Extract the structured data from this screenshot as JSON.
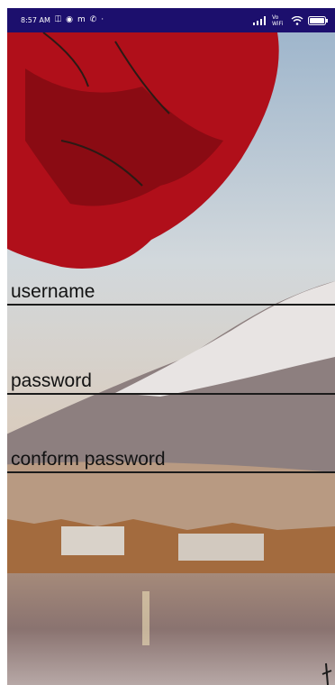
{
  "status_bar": {
    "time": "8:57 AM",
    "carrier": "Vo WiFi",
    "icons": [
      "alarm-icon",
      "chrome-icon",
      "mail-icon",
      "phone-icon",
      "signal-icon",
      "wifi-icon",
      "battery-icon"
    ],
    "background": "#1c0f6d"
  },
  "form": {
    "fields": [
      {
        "label": "username"
      },
      {
        "label": "password"
      },
      {
        "label": "conform password"
      }
    ]
  }
}
